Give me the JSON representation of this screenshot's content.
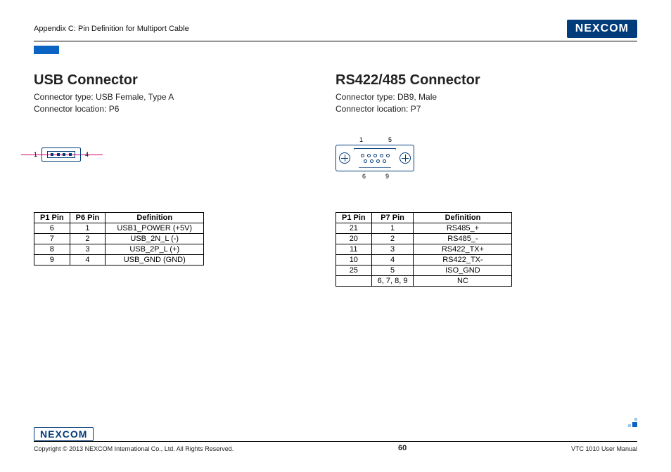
{
  "header": {
    "appendix": "Appendix C: Pin Definition for Multiport Cable",
    "logo_text": "NE COM",
    "logo_x": "X"
  },
  "usb": {
    "title": "USB Connector",
    "type_line": "Connector type: USB Female, Type A",
    "loc_line": "Connector location: P6",
    "pin_left": "1",
    "pin_right": "4",
    "headers": {
      "c1": "P1 Pin",
      "c2": "P6 Pin",
      "c3": "Definition"
    },
    "rows": [
      {
        "p1": "6",
        "p2": "1",
        "def": "USB1_POWER (+5V)"
      },
      {
        "p1": "7",
        "p2": "2",
        "def": "USB_2N_L (-)"
      },
      {
        "p1": "8",
        "p2": "3",
        "def": "USB_2P_L (+)"
      },
      {
        "p1": "9",
        "p2": "4",
        "def": "USB_GND (GND)"
      }
    ]
  },
  "rs": {
    "title": "RS422/485 Connector",
    "type_line": "Connector type: DB9, Male",
    "loc_line": "Connector location: P7",
    "pin_tl": "1",
    "pin_tr": "5",
    "pin_bl": "6",
    "pin_br": "9",
    "headers": {
      "c1": "P1 Pin",
      "c2": "P7 Pin",
      "c3": "Definition"
    },
    "rows": [
      {
        "p1": "21",
        "p2": "1",
        "def": "RS485_+"
      },
      {
        "p1": "20",
        "p2": "2",
        "def": "RS485_-"
      },
      {
        "p1": "11",
        "p2": "3",
        "def": "RS422_TX+"
      },
      {
        "p1": "10",
        "p2": "4",
        "def": "RS422_TX-"
      },
      {
        "p1": "25",
        "p2": "5",
        "def": "ISO_GND"
      },
      {
        "p1": "",
        "p2": "6, 7, 8, 9",
        "def": "NC"
      }
    ]
  },
  "footer": {
    "copyright": "Copyright © 2013 NEXCOM International Co., Ltd. All Rights Reserved.",
    "page": "60",
    "manual": "VTC 1010 User Manual",
    "logo_text": "NE COM",
    "logo_x": "X"
  }
}
